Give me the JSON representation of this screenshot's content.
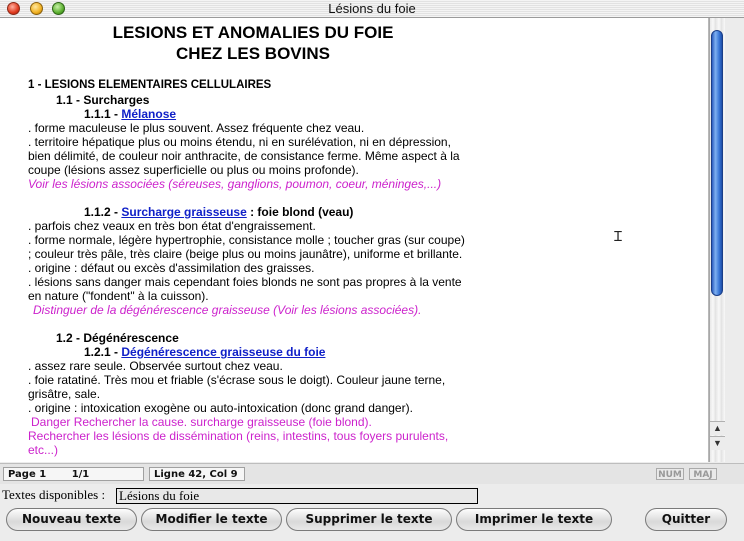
{
  "window": {
    "title": "Lésions du foie"
  },
  "document": {
    "title_line1": "LESIONS ET ANOMALIES DU FOIE",
    "title_line2": "CHEZ LES BOVINS",
    "s1_heading": "1 - LESIONS ELEMENTAIRES CELLULAIRES",
    "s11_heading": "1.1 - Surcharges",
    "s111_num": "1.1.1 - ",
    "s111_link": "Mélanose",
    "s111_lines": [
      ". forme maculeuse le plus souvent. Assez fréquente chez veau.",
      ". territoire hépatique plus ou moins étendu, ni en surélévation, ni en dépression,",
      "bien délimité, de couleur noir anthracite, de consistance ferme. Même aspect à la",
      "coupe (lésions assez superficielle ou plus ou moins profonde)."
    ],
    "s111_note": "Voir les lésions associées (séreuses, ganglions, poumon, coeur, méninges,...)",
    "s112_num": "1.1.2 - ",
    "s112_link": "Surcharge graisseuse",
    "s112_suffix": " : foie blond (veau)",
    "s112_lines": [
      ". parfois chez veaux en très bon état d'engraissement.",
      ". forme normale, légère hypertrophie, consistance molle ; toucher gras (sur coupe)",
      "; couleur très pâle, très claire (beige plus ou moins jaunâtre), uniforme et brillante.",
      ". origine : défaut ou excès d'assimilation des graisses.",
      ". lésions sans danger mais cependant foies blonds ne sont pas propres à la vente",
      "en nature (\"fondent\" à la cuisson)."
    ],
    "s112_note": "Distinguer de la dégénérescence graisseuse (Voir les lésions associées).",
    "s12_heading": "1.2 - Dégénérescence",
    "s121_num": "1.2.1 - ",
    "s121_link": "Dégénérescence graisseuse du foie",
    "s121_lines": [
      ". assez rare seule. Observée surtout chez veau.",
      ". foie ratatiné. Très mou et friable (s'écrase sous le doigt). Couleur jaune terne,",
      "grisâtre, sale.",
      ". origine : intoxication exogène ou auto-intoxication (donc grand danger)."
    ],
    "s121_note1": "Danger Rechercher la cause. surcharge graisseuse (foie blond).",
    "s121_note2": "Rechercher les lésions de dissémination (reins, intestins, tous foyers purulents,",
    "s121_note3": "etc...)"
  },
  "status": {
    "page": "Page 1",
    "page_count": "1/1",
    "position": "Ligne 42, Col 9",
    "num": "NUM",
    "maj": "MAJ"
  },
  "available": {
    "label": "Textes disponibles :",
    "value": "Lésions du foie"
  },
  "buttons": {
    "new": "Nouveau texte",
    "edit": "Modifier le texte",
    "delete": "Supprimer le texte",
    "print": "Imprimer le texte",
    "quit": "Quitter"
  },
  "colors": {
    "link": "#1020c8",
    "note": "#cc22cc",
    "scroll_thumb": "#3a78d8"
  }
}
